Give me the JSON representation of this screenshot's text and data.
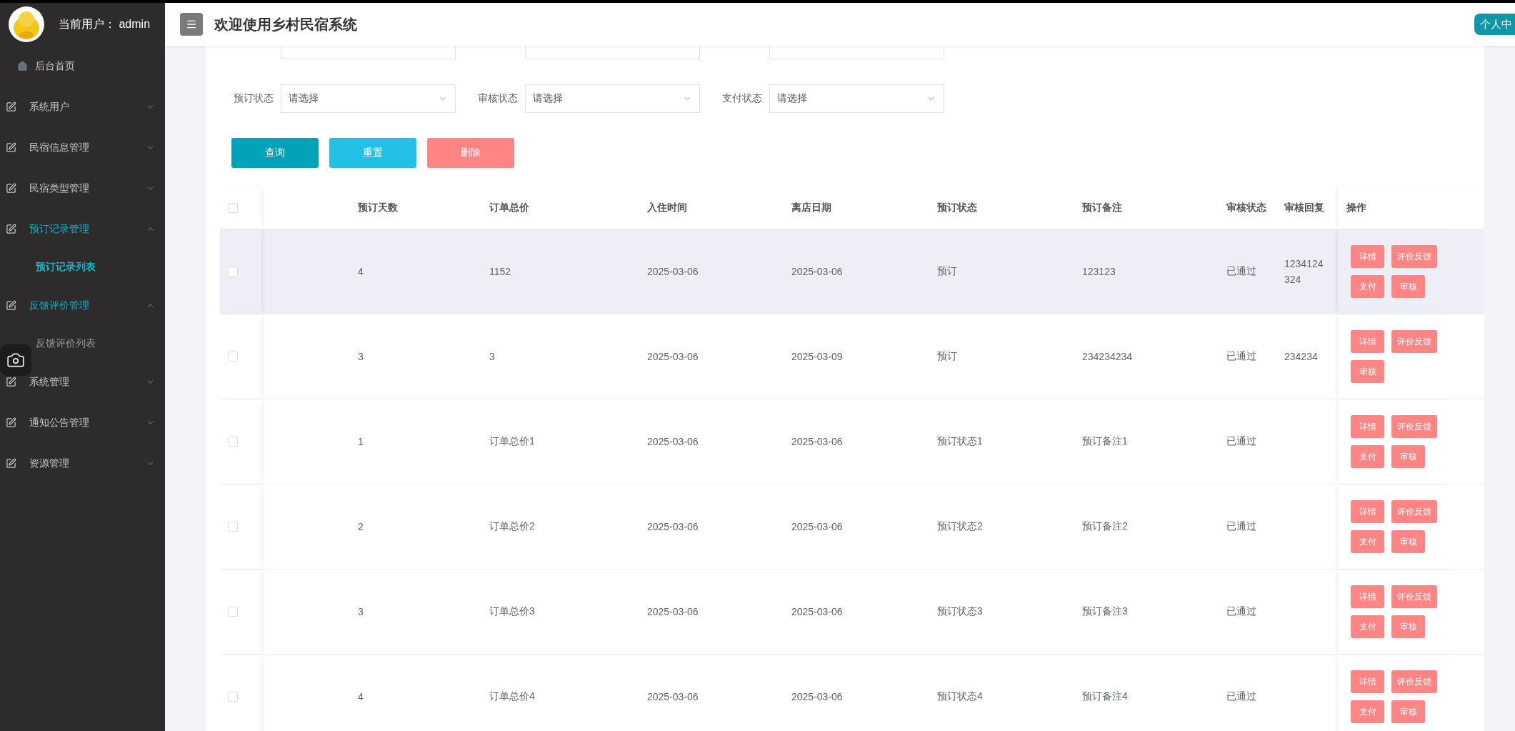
{
  "sidebar": {
    "user_label": "当前用户：",
    "username": "admin",
    "items": [
      {
        "kind": "home",
        "label": "后台首页"
      },
      {
        "kind": "menu",
        "label": "系统用户",
        "expanded": false
      },
      {
        "kind": "menu",
        "label": "民宿信息管理",
        "expanded": false
      },
      {
        "kind": "menu",
        "label": "民宿类型管理",
        "expanded": false
      },
      {
        "kind": "menu",
        "label": "预订记录管理",
        "expanded": true,
        "children": [
          {
            "label": "预订记录列表",
            "selected": true
          }
        ]
      },
      {
        "kind": "menu",
        "label": "反馈评价管理",
        "expanded": true,
        "children": [
          {
            "label": "反馈评价列表",
            "selected": false
          }
        ]
      },
      {
        "kind": "menu",
        "label": "系统管理",
        "expanded": false
      },
      {
        "kind": "menu",
        "label": "通知公告管理",
        "expanded": false
      },
      {
        "kind": "menu",
        "label": "资源管理",
        "expanded": false
      }
    ]
  },
  "header": {
    "title": "欢迎使用乡村民宿系统",
    "profile_button": "个人中"
  },
  "filters": {
    "text_fields": [
      {
        "kind": "text"
      },
      {
        "kind": "text"
      },
      {
        "kind": "text"
      }
    ],
    "selects": [
      {
        "label": "预订状态",
        "placeholder": "请选择"
      },
      {
        "label": "审核状态",
        "placeholder": "请选择"
      },
      {
        "label": "支付状态",
        "placeholder": "请选择"
      }
    ]
  },
  "buttons": [
    {
      "label": "查询",
      "kind": "primary"
    },
    {
      "label": "重置",
      "kind": "info"
    },
    {
      "label": "删除",
      "kind": "danger"
    }
  ],
  "table": {
    "header_checked": false,
    "columns": [
      "预订天数",
      "订单总价",
      "入住时间",
      "离店日期",
      "预订状态",
      "预订备注",
      "审核状态",
      "审核回复",
      "操作"
    ],
    "rows": [
      {
        "checked": false,
        "hovered": true,
        "cells": [
          "4",
          "1152",
          "2025-03-06",
          "2025-03-06",
          "预订",
          "123123",
          "已通过",
          "1234124324"
        ],
        "actions": [
          "详情",
          "评价反馈",
          "支付",
          "审核"
        ]
      },
      {
        "checked": false,
        "hovered": false,
        "cells": [
          "3",
          "3",
          "2025-03-06",
          "2025-03-09",
          "预订",
          "234234234",
          "已通过",
          "234234"
        ],
        "actions": [
          "详情",
          "评价反馈",
          "审核"
        ]
      },
      {
        "checked": false,
        "hovered": false,
        "cells": [
          "1",
          "订单总价1",
          "2025-03-06",
          "2025-03-06",
          "预订状态1",
          "预订备注1",
          "已通过"
        ],
        "actions": [
          "详情",
          "评价反馈",
          "支付",
          "审核"
        ]
      },
      {
        "checked": false,
        "hovered": false,
        "cells": [
          "2",
          "订单总价2",
          "2025-03-06",
          "2025-03-06",
          "预订状态2",
          "预订备注2",
          "已通过"
        ],
        "actions": [
          "详情",
          "评价反馈",
          "支付",
          "审核"
        ]
      },
      {
        "checked": false,
        "hovered": false,
        "cells": [
          "3",
          "订单总价3",
          "2025-03-06",
          "2025-03-06",
          "预订状态3",
          "预订备注3",
          "已通过"
        ],
        "actions": [
          "详情",
          "评价反馈",
          "支付",
          "审核"
        ]
      },
      {
        "checked": false,
        "hovered": false,
        "cells": [
          "4",
          "订单总价4",
          "2025-03-06",
          "2025-03-06",
          "预订状态4",
          "预订备注4",
          "已通过"
        ],
        "actions": [
          "详情",
          "评价反馈",
          "支付",
          "审核"
        ]
      }
    ]
  }
}
